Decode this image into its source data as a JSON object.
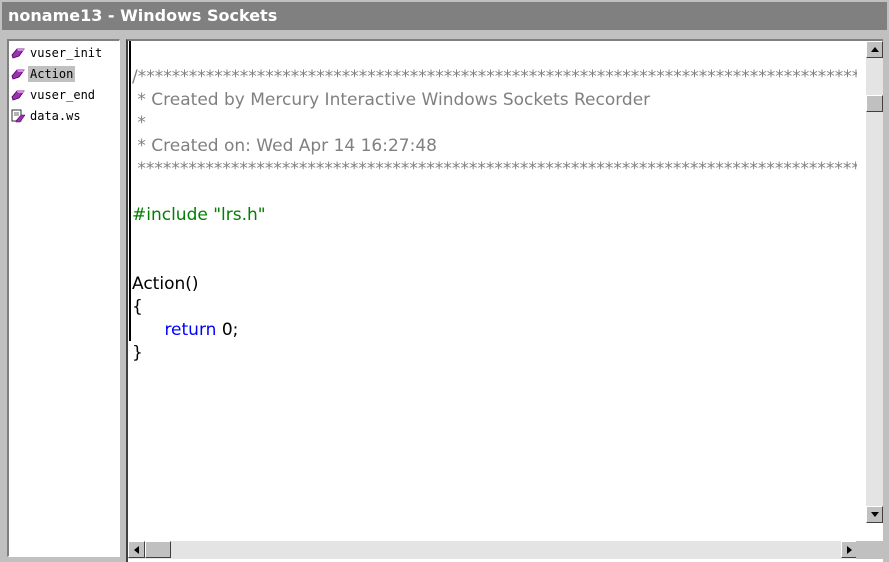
{
  "window": {
    "title": "noname13 - Windows Sockets"
  },
  "tree": {
    "items": [
      {
        "label": "vuser_init",
        "icon": "purple-gem-icon",
        "selected": false
      },
      {
        "label": "Action",
        "icon": "purple-gem-icon",
        "selected": true
      },
      {
        "label": "vuser_end",
        "icon": "purple-gem-icon",
        "selected": false
      },
      {
        "label": "data.ws",
        "icon": "data-file-icon",
        "selected": false
      }
    ]
  },
  "code": {
    "header_border": "/*****************************************************************************************",
    "header_line1": " * Created by Mercury Interactive Windows Sockets Recorder",
    "header_line2": " *",
    "header_line3": " * Created on: Wed Apr 14 16:27:48",
    "header_footer": " *****************************************************************************************",
    "include_line": "#include \"lrs.h\"",
    "func_decl": "Action()",
    "open_brace": "{",
    "return_kw": "return",
    "return_val": " 0;",
    "close_brace": "}"
  },
  "colors": {
    "comment": "#808080",
    "preprocessor": "#008000",
    "keyword": "#0000ff"
  }
}
